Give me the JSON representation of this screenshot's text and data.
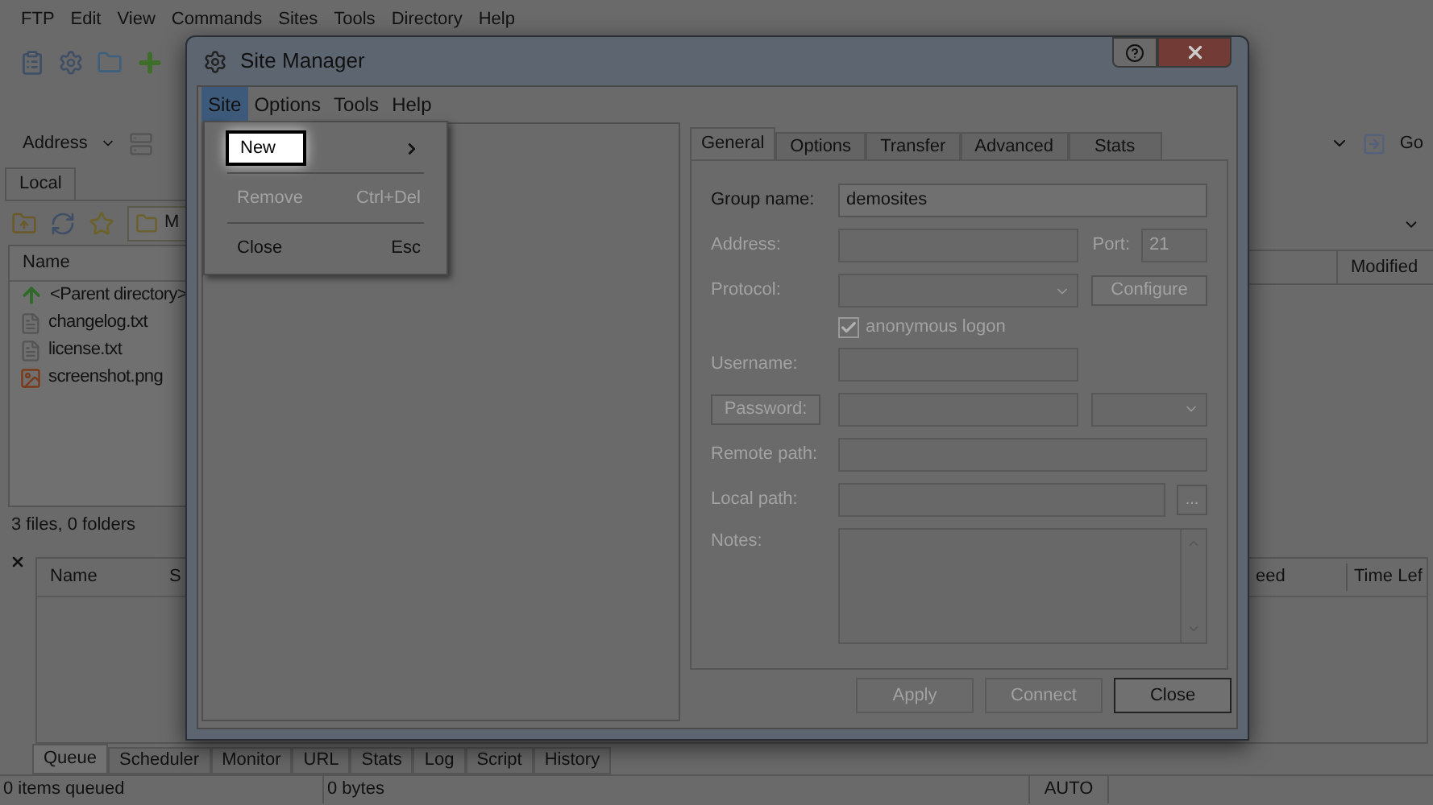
{
  "app_menu": [
    "FTP",
    "Edit",
    "View",
    "Commands",
    "Sites",
    "Tools",
    "Directory",
    "Help"
  ],
  "address_bar": {
    "label": "Address",
    "go": "Go"
  },
  "local_pane": {
    "tab": "Local",
    "path": "M",
    "column": "Name",
    "files": [
      {
        "name": "<Parent directory>",
        "kind": "parent"
      },
      {
        "name": "changelog.txt",
        "kind": "text"
      },
      {
        "name": "license.txt",
        "kind": "text"
      },
      {
        "name": "screenshot.png",
        "kind": "image"
      }
    ],
    "status": "3 files, 0 folders"
  },
  "remote_pane": {
    "column": "Modified"
  },
  "queue": {
    "columns": [
      "Name",
      "S",
      "eed",
      "Time Lef"
    ]
  },
  "bottom_tabs": [
    {
      "label": "Queue",
      "selected": true
    },
    {
      "label": "Scheduler",
      "selected": false
    },
    {
      "label": "Monitor",
      "selected": false
    },
    {
      "label": "URL",
      "selected": false
    },
    {
      "label": "Stats",
      "selected": false
    },
    {
      "label": "Log",
      "selected": false
    },
    {
      "label": "Script",
      "selected": false
    },
    {
      "label": "History",
      "selected": false
    }
  ],
  "status_bar": [
    "0 items queued",
    "0 bytes",
    "AUTO"
  ],
  "dialog": {
    "title": "Site Manager",
    "menu": [
      {
        "label": "Site",
        "selected": true
      },
      {
        "label": "Options",
        "selected": false
      },
      {
        "label": "Tools",
        "selected": false
      },
      {
        "label": "Help",
        "selected": false
      }
    ],
    "site_menu": [
      {
        "label": "New",
        "kind": "submenu",
        "selected": true,
        "disabled": false
      },
      {
        "label": "Remove",
        "shortcut": "Ctrl+Del",
        "kind": "command",
        "selected": false,
        "disabled": true
      },
      {
        "label": "Close",
        "shortcut": "Esc",
        "kind": "command",
        "selected": false,
        "disabled": false
      }
    ],
    "tabs": [
      {
        "label": "General",
        "selected": true
      },
      {
        "label": "Options",
        "selected": false
      },
      {
        "label": "Transfer",
        "selected": false
      },
      {
        "label": "Advanced",
        "selected": false
      },
      {
        "label": "Stats",
        "selected": false
      }
    ],
    "group_name": {
      "label": "Group name:",
      "value": "demosites",
      "disabled": false
    },
    "address": {
      "label": "Address:",
      "disabled": true
    },
    "port": {
      "label": "Port:",
      "value": "21",
      "disabled": true
    },
    "protocol": {
      "label": "Protocol:",
      "disabled": true
    },
    "configure": {
      "label": "Configure",
      "disabled": true
    },
    "anonymous": {
      "label": "anonymous logon",
      "checked": true,
      "disabled": true
    },
    "username": {
      "label": "Username:",
      "disabled": true
    },
    "password": {
      "label": "Password:",
      "disabled": true
    },
    "remote_path": {
      "label": "Remote path:",
      "disabled": true
    },
    "local_path": {
      "label": "Local path:",
      "browse": "...",
      "disabled": true
    },
    "notes": {
      "label": "Notes:",
      "disabled": true
    },
    "buttons": [
      {
        "label": "Apply",
        "disabled": true
      },
      {
        "label": "Connect",
        "disabled": true
      },
      {
        "label": "Close",
        "disabled": false
      }
    ]
  }
}
